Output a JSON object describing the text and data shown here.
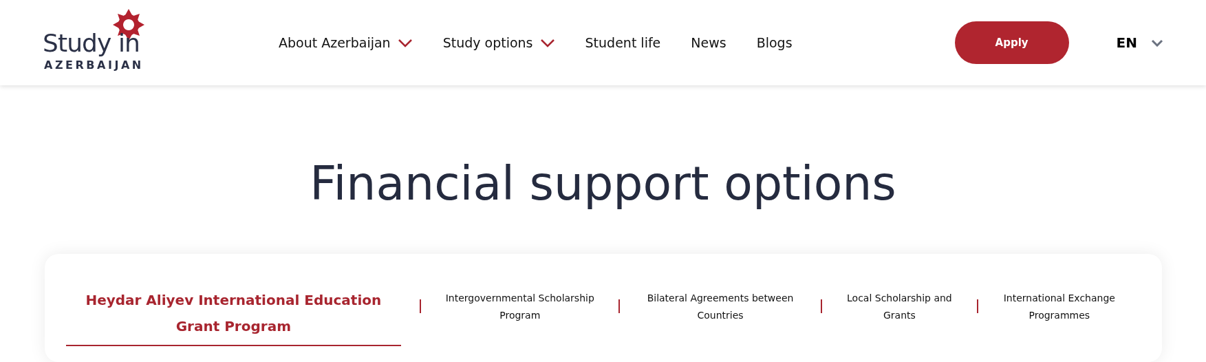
{
  "logo": {
    "line_1": "Study in",
    "line_2": "AZERBAIJAN"
  },
  "nav": [
    {
      "label": "About Azerbaijan",
      "has_dropdown": true
    },
    {
      "label": "Study options",
      "has_dropdown": true
    },
    {
      "label": "Student life",
      "has_dropdown": false
    },
    {
      "label": "News",
      "has_dropdown": false
    },
    {
      "label": "Blogs",
      "has_dropdown": false
    }
  ],
  "apply_button": "Apply",
  "language": "EN",
  "title": "Financial support options",
  "tabs": [
    {
      "label": "Heydar Aliyev International Education Grant Program",
      "selected": true
    },
    {
      "label": "Intergovernmental Scholarship Program",
      "selected": false
    },
    {
      "label": "Bilateral Agreements between Countries",
      "selected": false
    },
    {
      "label": "Local Scholarship and Grants",
      "selected": false
    },
    {
      "label": "International Exchange Programmes",
      "selected": false
    }
  ]
}
